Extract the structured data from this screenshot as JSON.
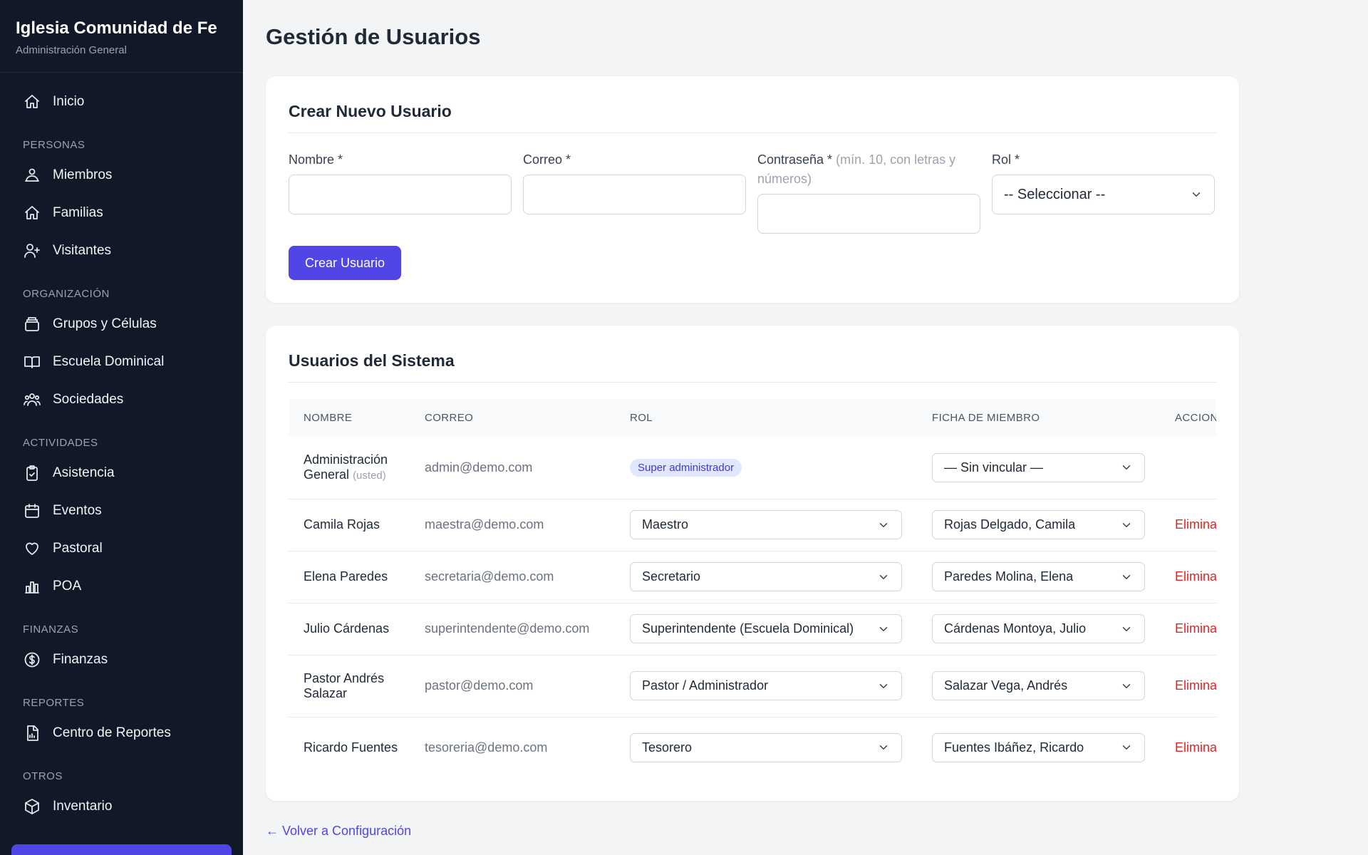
{
  "sidebar": {
    "title": "Iglesia Comunidad de Fe",
    "subtitle": "Administración General",
    "home": {
      "label": "Inicio",
      "icon": "home-icon"
    },
    "sections": [
      {
        "title": "PERSONAS",
        "items": [
          {
            "label": "Miembros",
            "icon": "members-icon"
          },
          {
            "label": "Familias",
            "icon": "house-icon"
          },
          {
            "label": "Visitantes",
            "icon": "user-plus-icon"
          }
        ]
      },
      {
        "title": "ORGANIZACIÓN",
        "items": [
          {
            "label": "Grupos y Células",
            "icon": "layers-icon"
          },
          {
            "label": "Escuela Dominical",
            "icon": "book-open-icon"
          },
          {
            "label": "Sociedades",
            "icon": "users-icon"
          }
        ]
      },
      {
        "title": "ACTIVIDADES",
        "items": [
          {
            "label": "Asistencia",
            "icon": "clipboard-check-icon"
          },
          {
            "label": "Eventos",
            "icon": "calendar-icon"
          },
          {
            "label": "Pastoral",
            "icon": "heart-icon"
          },
          {
            "label": "POA",
            "icon": "bar-chart-icon"
          }
        ]
      },
      {
        "title": "FINANZAS",
        "items": [
          {
            "label": "Finanzas",
            "icon": "dollar-circle-icon"
          }
        ]
      },
      {
        "title": "REPORTES",
        "items": [
          {
            "label": "Centro de Reportes",
            "icon": "report-icon"
          }
        ]
      },
      {
        "title": "OTROS",
        "items": [
          {
            "label": "Inventario",
            "icon": "cube-icon"
          }
        ]
      }
    ]
  },
  "page": {
    "title": "Gestión de Usuarios"
  },
  "create": {
    "title": "Crear Nuevo Usuario",
    "name_label": "Nombre *",
    "email_label": "Correo *",
    "password_label": "Contraseña *",
    "password_hint": "(mín. 10, con letras y números)",
    "role_label": "Rol *",
    "role_placeholder": "-- Seleccionar --",
    "submit": "Crear Usuario"
  },
  "users": {
    "title": "Usuarios del Sistema",
    "columns": [
      "NOMBRE",
      "CORREO",
      "ROL",
      "FICHA DE MIEMBRO",
      "ACCIONES"
    ],
    "rows": [
      {
        "name": "Administración General",
        "suffix": "(usted)",
        "email": "admin@demo.com",
        "role_badge": "Super administrador",
        "member": "— Sin vincular —",
        "action": ""
      },
      {
        "name": "Camila Rojas",
        "email": "maestra@demo.com",
        "role": "Maestro",
        "member": "Rojas Delgado, Camila",
        "action": "Eliminar"
      },
      {
        "name": "Elena Paredes",
        "email": "secretaria@demo.com",
        "role": "Secretario",
        "member": "Paredes Molina, Elena",
        "action": "Eliminar"
      },
      {
        "name": "Julio Cárdenas",
        "email": "superintendente@demo.com",
        "role": "Superintendente (Escuela Dominical)",
        "member": "Cárdenas Montoya, Julio",
        "action": "Eliminar"
      },
      {
        "name": "Pastor Andrés Salazar",
        "email": "pastor@demo.com",
        "role": "Pastor / Administrador",
        "member": "Salazar Vega, Andrés",
        "action": "Eliminar"
      },
      {
        "name": "Ricardo Fuentes",
        "email": "tesoreria@demo.com",
        "role": "Tesorero",
        "member": "Fuentes Ibáñez, Ricardo",
        "action": "Eliminar"
      }
    ]
  },
  "back_link": "← Volver a Configuración"
}
